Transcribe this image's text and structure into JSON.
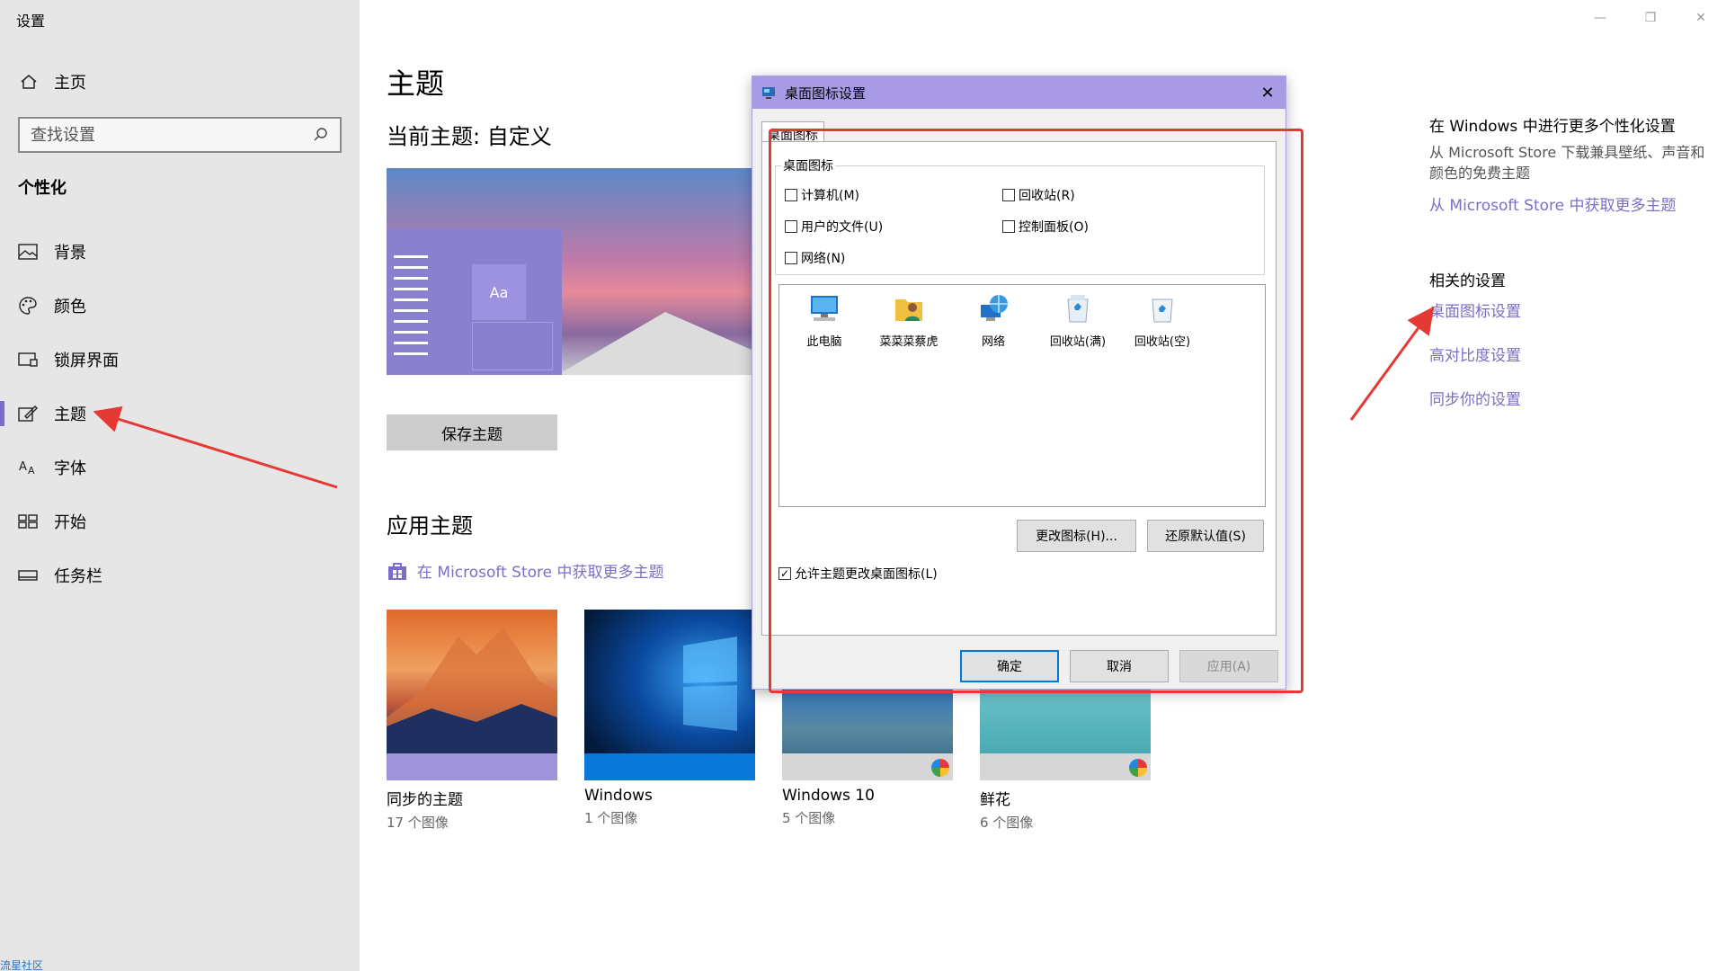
{
  "window": {
    "title": "设置",
    "controls": {
      "minimize": "—",
      "restore": "❐",
      "close": "✕"
    }
  },
  "sidebar": {
    "home_label": "主页",
    "search_placeholder": "查找设置",
    "section_title": "个性化",
    "items": [
      {
        "label": "背景",
        "icon": "picture-icon"
      },
      {
        "label": "颜色",
        "icon": "palette-icon"
      },
      {
        "label": "锁屏界面",
        "icon": "lockscreen-icon"
      },
      {
        "label": "主题",
        "icon": "theme-brush-icon",
        "active": true
      },
      {
        "label": "字体",
        "icon": "font-icon"
      },
      {
        "label": "开始",
        "icon": "start-icon"
      },
      {
        "label": "任务栏",
        "icon": "taskbar-icon"
      }
    ],
    "footer": "流星社区"
  },
  "main": {
    "page_title": "主题",
    "current_theme": "当前主题: 自定义",
    "preview_tile_text": "Aa",
    "save_theme_label": "保存主题",
    "apply_title": "应用主题",
    "store_link": "在 Microsoft Store 中获取更多主题",
    "themes": [
      {
        "name": "同步的主题",
        "count": "17 个图像"
      },
      {
        "name": "Windows",
        "count": "1 个图像"
      },
      {
        "name": "Windows 10",
        "count": "5 个图像"
      },
      {
        "name": "鲜花",
        "count": "6 个图像"
      }
    ]
  },
  "right_panel": {
    "title": "在 Windows 中进行更多个性化设置",
    "text": "从 Microsoft Store 下载兼具壁纸、声音和颜色的免费主题",
    "store_link": "从 Microsoft Store 中获取更多主题",
    "related_title": "相关的设置",
    "related_links": [
      "桌面图标设置",
      "高对比度设置",
      "同步你的设置"
    ]
  },
  "dialog": {
    "title": "桌面图标设置",
    "tab": "桌面图标",
    "group_label": "桌面图标",
    "checkboxes": [
      {
        "label": "计算机(M)",
        "checked": false
      },
      {
        "label": "回收站(R)",
        "checked": false
      },
      {
        "label": "用户的文件(U)",
        "checked": false
      },
      {
        "label": "控制面板(O)",
        "checked": false
      },
      {
        "label": "网络(N)",
        "checked": false
      }
    ],
    "icons": [
      "此电脑",
      "菜菜菜蔡虎",
      "网络",
      "回收站(满)",
      "回收站(空)"
    ],
    "change_icon_label": "更改图标(H)...",
    "restore_default_label": "还原默认值(S)",
    "allow_theme_label": "允许主题更改桌面图标(L)",
    "allow_theme_checked": true,
    "ok_label": "确定",
    "cancel_label": "取消",
    "apply_label": "应用(A)"
  }
}
